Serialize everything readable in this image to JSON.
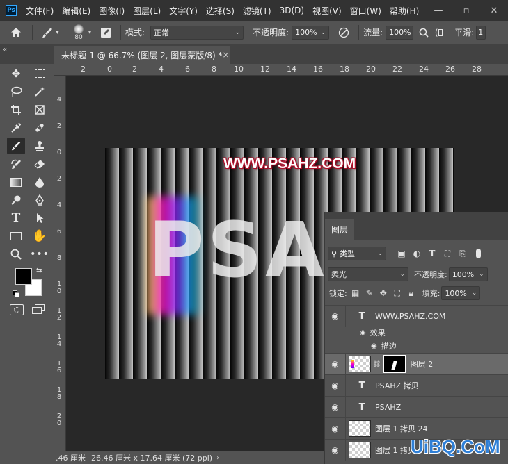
{
  "app": {
    "logo": "Ps",
    "menu": [
      "文件(F)",
      "编辑(E)",
      "图像(I)",
      "图层(L)",
      "文字(Y)",
      "选择(S)",
      "滤镜(T)",
      "3D(D)",
      "视图(V)",
      "窗口(W)",
      "帮助(H)"
    ],
    "window_controls": [
      "—",
      "▫",
      "✕"
    ]
  },
  "options": {
    "brush_size": "80",
    "mode_label": "模式:",
    "mode_value": "正常",
    "opacity_label": "不透明度:",
    "opacity_value": "100%",
    "flow_label": "流量:",
    "flow_value": "100%",
    "smoothing_label": "平滑:",
    "smoothing_value": "1"
  },
  "document": {
    "collapse_glyph": "«",
    "tab_title": "未标题-1 @ 66.7% (图层 2, 图层蒙版/8) *",
    "close_glyph": "×",
    "ruler_top": [
      "2",
      "0",
      "2",
      "4",
      "6",
      "8",
      "10",
      "12",
      "14",
      "16",
      "18",
      "20",
      "22",
      "24",
      "26",
      "28"
    ],
    "ruler_left": [
      "4",
      "2",
      "0",
      "2",
      "4",
      "6",
      "8",
      "10",
      "12",
      "14",
      "16",
      "18",
      "20"
    ],
    "url_text": "WWW.PSAHZ.COM",
    "big_text": "PSAHZ"
  },
  "status": {
    "zoom": ".46 厘米",
    "info": "26.46 厘米 x 17.64 厘米 (72 ppi)",
    "arrow": "›"
  },
  "layers_panel": {
    "tab": "图层",
    "filter_label": "类型",
    "blend_mode": "柔光",
    "opacity_label": "不透明度:",
    "opacity_value": "100%",
    "lock_label": "锁定:",
    "fill_label": "填充:",
    "fill_value": "100%",
    "layers": [
      {
        "name": "WWW.PSAHZ.COM",
        "kind": "text"
      },
      {
        "name": "效果",
        "kind": "effects"
      },
      {
        "name": "描边",
        "kind": "effect-item"
      },
      {
        "name": "图层 2",
        "kind": "masked",
        "selected": true
      },
      {
        "name": "PSAHZ 拷贝",
        "kind": "text"
      },
      {
        "name": "PSAHZ",
        "kind": "text"
      },
      {
        "name": "图层 1 拷贝 24",
        "kind": "pixel"
      },
      {
        "name": "图层 1 拷贝",
        "kind": "pixel"
      }
    ]
  },
  "watermark": "UiBQ.CoM",
  "colors": {
    "accent": "#31a8ff",
    "panel": "#535353",
    "canvas_bg": "#282828",
    "url_stroke": "#b0102a"
  }
}
